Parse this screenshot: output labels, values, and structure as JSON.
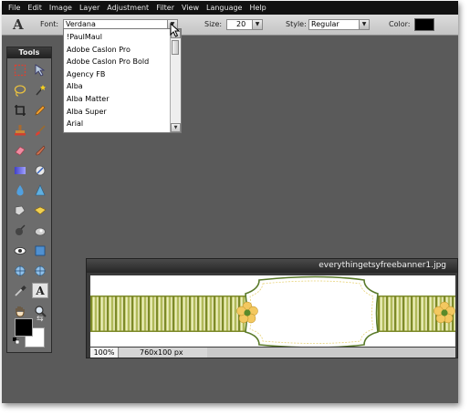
{
  "menubar": {
    "items": [
      "File",
      "Edit",
      "Image",
      "Layer",
      "Adjustment",
      "Filter",
      "View",
      "Language",
      "Help"
    ]
  },
  "options_bar": {
    "tool_glyph": "A",
    "font_label": "Font:",
    "font_value": "Verdana",
    "size_label": "Size:",
    "size_value": "20",
    "style_label": "Style:",
    "style_value": "Regular",
    "color_label": "Color:",
    "color_value": "#000000"
  },
  "font_dropdown": {
    "options": [
      "!PaulMaul",
      "Adobe Caslon Pro",
      "Adobe Caslon Pro Bold",
      "Agency FB",
      "Alba",
      "Alba Matter",
      "Alba Super",
      "Arial"
    ]
  },
  "tools_panel": {
    "title": "Tools",
    "tools": [
      "marquee",
      "move",
      "lasso",
      "magic-wand",
      "crop",
      "pencil",
      "stamp",
      "brush",
      "eraser",
      "smudge",
      "gradient",
      "replace-color",
      "drop",
      "sharpen",
      "sponge",
      "fill",
      "bucket",
      "clone",
      "eye",
      "rectangle",
      "pinch",
      "bloat",
      "eyedropper",
      "type",
      "hand",
      "zoom"
    ],
    "foreground_color": "#000000",
    "background_color": "#ffffff"
  },
  "document": {
    "title": "everythingetsyfreebanner1.jpg",
    "zoom": "100%",
    "dimensions": "760x100 px"
  },
  "colors": {
    "workspace": "#5a5a5a",
    "menubar": "#111111",
    "banner_green": "#a6b04a",
    "banner_stripe_light": "#d9dc9a"
  }
}
